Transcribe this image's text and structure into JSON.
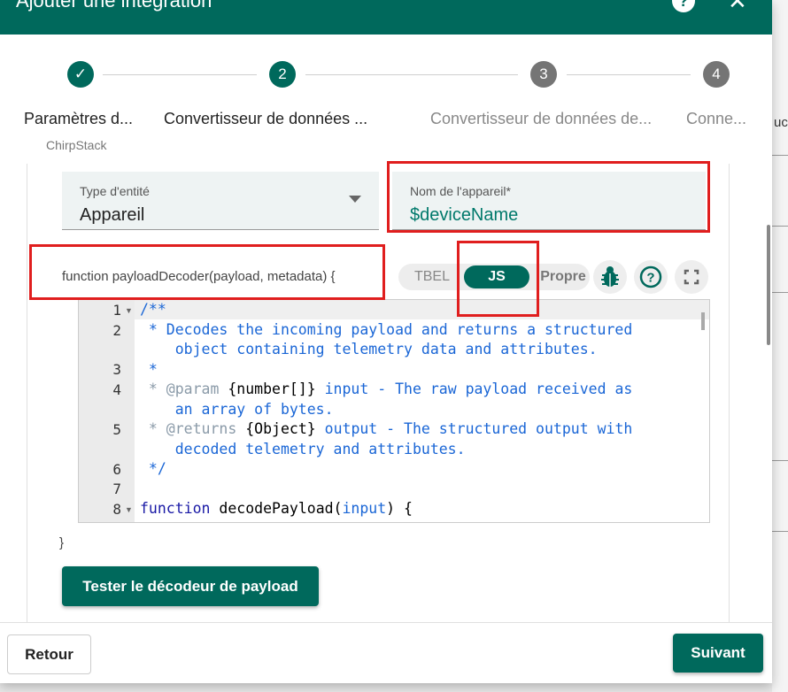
{
  "header": {
    "title": "Ajouter une intégration"
  },
  "stepper": {
    "steps": [
      {
        "number": "✓",
        "label": "Paramètres d...",
        "sublabel": "ChirpStack"
      },
      {
        "number": "2",
        "label": "Convertisseur de données ..."
      },
      {
        "number": "3",
        "label": "Convertisseur de données de..."
      },
      {
        "number": "4",
        "label": "Conne..."
      }
    ]
  },
  "form": {
    "entity_type": {
      "label": "Type d'entité",
      "value": "Appareil"
    },
    "device_name": {
      "label": "Nom de l'appareil*",
      "value": "$deviceName"
    }
  },
  "decoder": {
    "signature": "function payloadDecoder(payload, metadata) {",
    "closing": "}",
    "modes": {
      "tbel": "TBEL",
      "js": "JS",
      "propre": "Propre"
    },
    "selected_mode": "JS",
    "line_numbers": [
      "1",
      "2",
      "3",
      "4",
      "5",
      "6",
      "7",
      "8"
    ],
    "code": {
      "l1": "/**",
      "l2a": " * Decodes the incoming payload and returns a structured",
      "l2b": "    object containing telemetry data and attributes.",
      "l3": " *",
      "l4_tag": " * @param ",
      "l4_type": "{number[]}",
      "l4_rest": " input - The raw payload received as",
      "l4b": "    an array of bytes.",
      "l5_tag": " * @returns ",
      "l5_type": "{Object}",
      "l5_rest": " output - The structured output with",
      "l5b": "    decoded telemetry and attributes.",
      "l6": " */",
      "l8_kw": "function",
      "l8_name": " decodePayload(",
      "l8_arg": "input",
      "l8_end": ") {"
    },
    "test_button": "Tester le décodeur de payload"
  },
  "footer": {
    "back": "Retour",
    "next": "Suivant"
  },
  "background": {
    "peek": "uc"
  },
  "colors": {
    "primary": "#00695c",
    "highlight": "#e01e1e",
    "inactive_step": "#757575"
  }
}
